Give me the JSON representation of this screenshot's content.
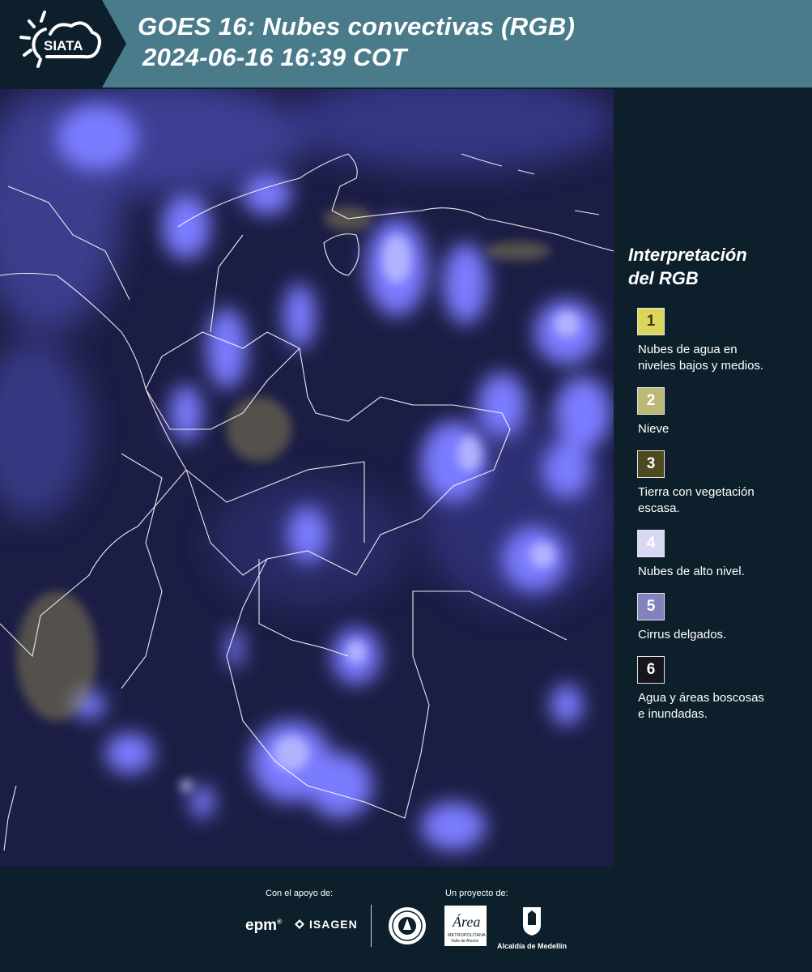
{
  "header": {
    "logo_text": "SIATA",
    "title_line1": "GOES 16: Nubes convectivas (RGB)",
    "title_line2": "2024-06-16 16:39 COT",
    "background_color": "#4a7b8a",
    "logo_background_color": "#0c1f2b"
  },
  "map": {
    "description_icon": "satellite-rgb-image",
    "background_color": "#1c1d45",
    "cloud_color": "#6a6cff",
    "border_color": "#ffffff"
  },
  "legend": {
    "title_line1": "Interpretación",
    "title_line2": "del RGB",
    "items": [
      {
        "number": "1",
        "label_line1": "Nubes de agua en",
        "label_line2": "niveles bajos y medios.",
        "color": "#dcd75a",
        "text_color": "#3b3a1a"
      },
      {
        "number": "2",
        "label_line1": "Nieve",
        "label_line2": "",
        "color": "#bcb978",
        "text_color": "#ffffff"
      },
      {
        "number": "3",
        "label_line1": "Tierra con vegetación",
        "label_line2": "escasa.",
        "color": "#4e4a20",
        "text_color": "#ffffff"
      },
      {
        "number": "4",
        "label_line1": "Nubes de alto nivel.",
        "label_line2": "",
        "color": "#d8d8f4",
        "text_color": "#ffffff"
      },
      {
        "number": "5",
        "label_line1": "Cirrus delgados.",
        "label_line2": "",
        "color": "#8283be",
        "text_color": "#ffffff"
      },
      {
        "number": "6",
        "label_line1": "Agua y áreas boscosas",
        "label_line2": "e inundadas.",
        "color": "#16161e",
        "text_color": "#ffffff"
      }
    ]
  },
  "footer": {
    "support_label": "Con el apoyo de:",
    "project_label": "Un proyecto de:",
    "sponsor1": "epm",
    "sponsor2": "ISAGEN",
    "area_logo_word": "Área",
    "area_logo_sub1": "METROPOLITANA",
    "area_logo_sub2": "Valle de Aburrá",
    "alcaldia_label": "Alcaldía de Medellín"
  }
}
